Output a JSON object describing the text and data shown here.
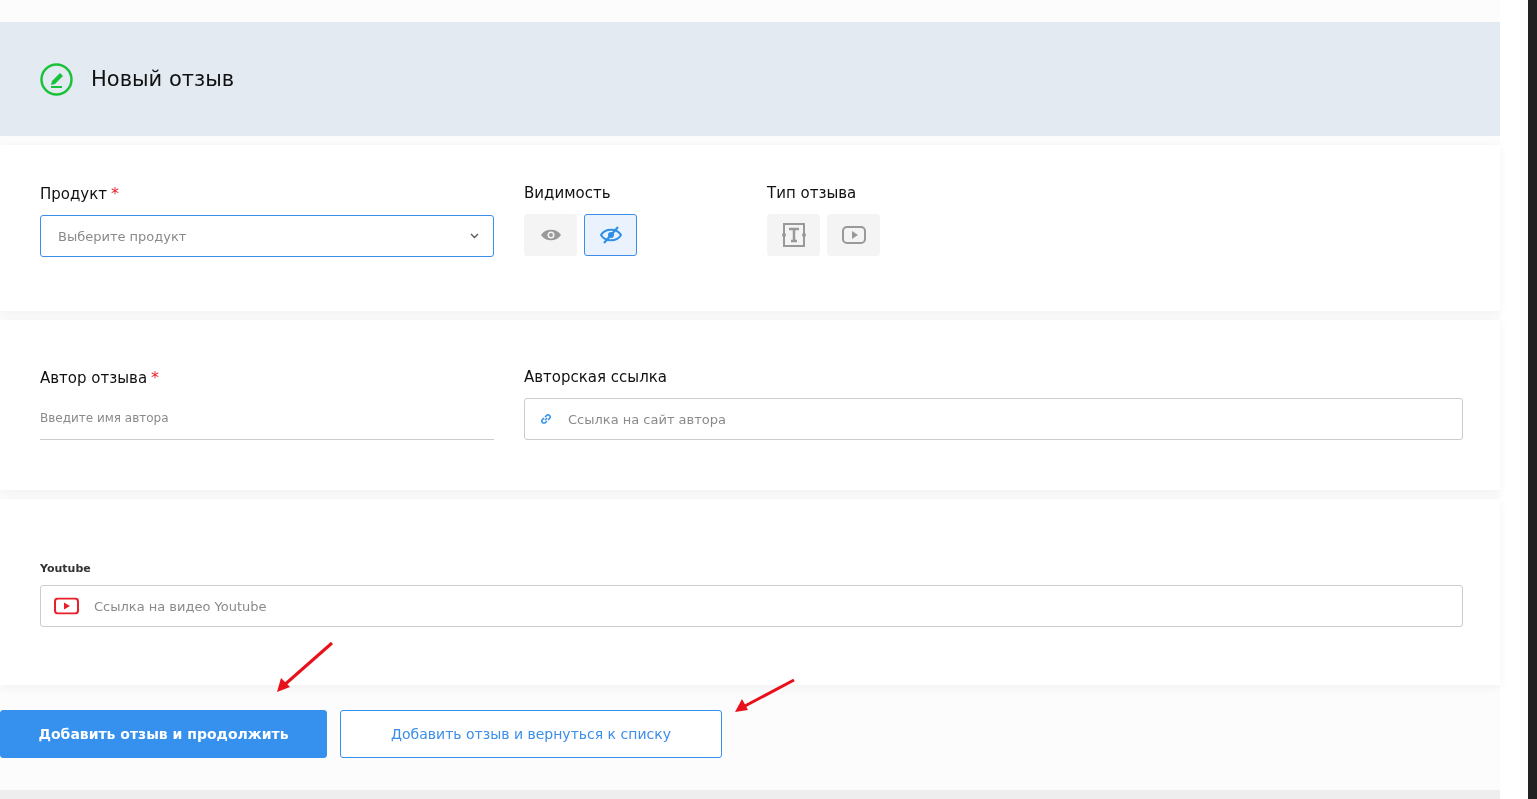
{
  "header": {
    "title": "Новый отзыв"
  },
  "product": {
    "label": "Продукт",
    "required_mark": "*",
    "placeholder": "Выберите продукт"
  },
  "visibility": {
    "label": "Видимость",
    "options": [
      {
        "kind": "visible",
        "selected": false
      },
      {
        "kind": "hidden",
        "selected": true
      }
    ]
  },
  "review_type": {
    "label": "Тип отзыва",
    "options": [
      {
        "kind": "text",
        "selected": false
      },
      {
        "kind": "video",
        "selected": false
      }
    ]
  },
  "author": {
    "label": "Автор отзыва",
    "required_mark": "*",
    "placeholder": "Введите имя автора"
  },
  "author_link": {
    "label": "Авторская ссылка",
    "placeholder": "Ссылка на сайт автора"
  },
  "youtube": {
    "label": "Youtube",
    "placeholder": "Ссылка на видео Youtube"
  },
  "buttons": [
    {
      "label": "Добавить отзыв и продолжить",
      "kind": "primary"
    },
    {
      "label": "Добавить отзыв и вернуться к списку",
      "kind": "secondary"
    }
  ]
}
